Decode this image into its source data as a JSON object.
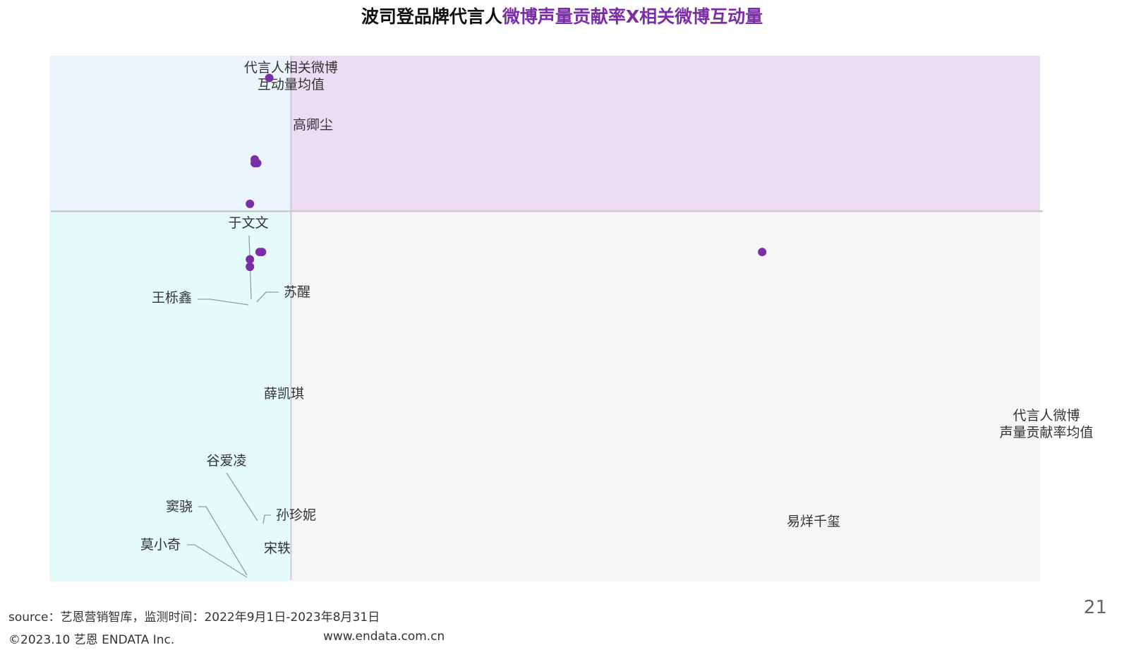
{
  "title": {
    "black": "波司登品牌代言人",
    "purple": "微博声量贡献率X相关微博互动量"
  },
  "colors": {
    "title_black": "#111111",
    "accent_purple": "#7b2fa6",
    "point": "#7b2fa6",
    "quadrant_top_left": "#eaf5fd",
    "quadrant_top_right": "#ecdcf4",
    "quadrant_bottom_left": "#e5fbf9",
    "quadrant_bottom_right": "#f6f6f7"
  },
  "chart_data": {
    "type": "scatter",
    "title": "波司登品牌代言人微博声量贡献率X相关微博互动量",
    "x_reference_label": [
      "代言人微博",
      "声量贡献率均值"
    ],
    "y_reference_label": [
      "代言人相关微博",
      "互动量均值"
    ],
    "x_reference": 1.0,
    "y_reference": 1.0,
    "xlim": [
      0,
      4.1
    ],
    "ylim": [
      0,
      1.42
    ],
    "points": [
      {
        "label": "高卿尘",
        "x": 0.91,
        "y": 1.36
      },
      {
        "label": "于文文",
        "x": 0.85,
        "y": 1.14
      },
      {
        "label": "苏醒",
        "x": 0.86,
        "y": 1.13
      },
      {
        "label": "王栎鑫",
        "x": 0.85,
        "y": 1.13
      },
      {
        "label": "薛凯琪",
        "x": 0.83,
        "y": 1.02
      },
      {
        "label": "谷爱凌",
        "x": 0.87,
        "y": 0.89
      },
      {
        "label": "孙珍妮",
        "x": 0.88,
        "y": 0.89
      },
      {
        "label": "宋轶",
        "x": 0.83,
        "y": 0.87
      },
      {
        "label": "窦骁",
        "x": 0.83,
        "y": 0.85
      },
      {
        "label": "莫小奇",
        "x": 0.83,
        "y": 0.85
      },
      {
        "label": "易烊千玺",
        "x": 2.95,
        "y": 0.89
      }
    ]
  },
  "footer": {
    "source": "source：艺恩营销智库，监测时间：2022年9月1日-2023年8月31日",
    "copyright": "©2023.10  艺恩 ENDATA Inc.",
    "url": "www.endata.com.cn"
  },
  "page_number": "21"
}
